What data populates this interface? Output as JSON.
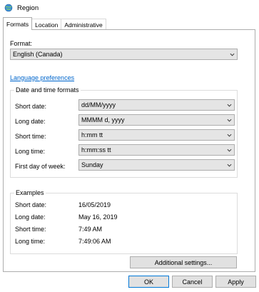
{
  "window": {
    "title": "Region"
  },
  "tabs": [
    {
      "label": "Formats",
      "active": true
    },
    {
      "label": "Location",
      "active": false
    },
    {
      "label": "Administrative",
      "active": false
    }
  ],
  "format": {
    "label": "Format:",
    "value": "English (Canada)"
  },
  "language_link": "Language preferences",
  "date_time": {
    "title": "Date and time formats",
    "rows": [
      {
        "label": "Short date:",
        "value": "dd/MM/yyyy"
      },
      {
        "label": "Long date:",
        "value": "MMMM d, yyyy"
      },
      {
        "label": "Short time:",
        "value": "h:mm tt"
      },
      {
        "label": "Long time:",
        "value": "h:mm:ss tt"
      },
      {
        "label": "First day of week:",
        "value": "Sunday"
      }
    ]
  },
  "examples": {
    "title": "Examples",
    "rows": [
      {
        "label": "Short date:",
        "value": "16/05/2019"
      },
      {
        "label": "Long date:",
        "value": "May 16, 2019"
      },
      {
        "label": "Short time:",
        "value": "7:49 AM"
      },
      {
        "label": "Long time:",
        "value": "7:49:06 AM"
      }
    ]
  },
  "buttons": {
    "additional": "Additional settings...",
    "ok": "OK",
    "cancel": "Cancel",
    "apply": "Apply"
  },
  "colors": {
    "link": "#0066cc",
    "combo_bg": "#e5e5e5",
    "focus_border": "#0078d7"
  },
  "icons": {
    "app": "globe-icon",
    "dropdown": "chevron-down-icon"
  }
}
